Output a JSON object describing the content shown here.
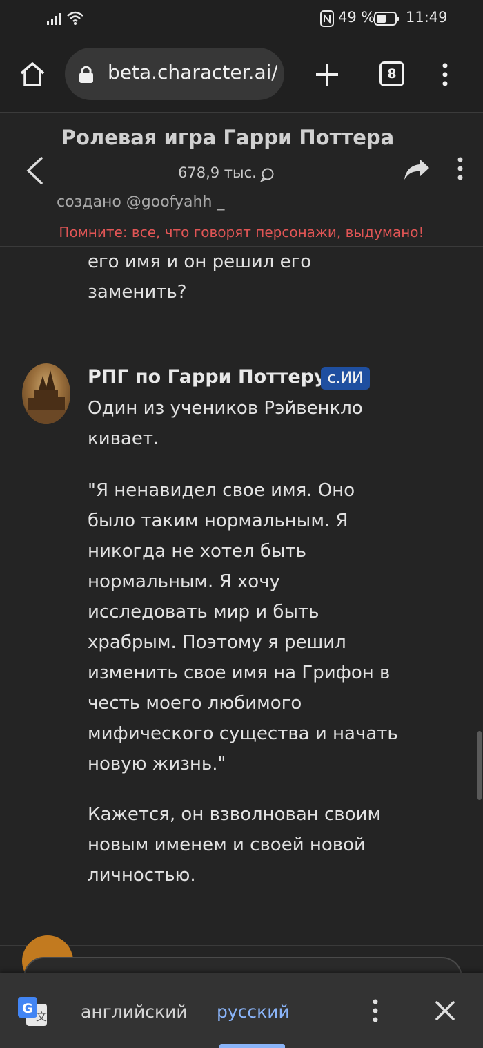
{
  "status_bar": {
    "battery": "49 %",
    "time": "11:49"
  },
  "browser": {
    "url": "beta.character.ai/",
    "tab_count": "8"
  },
  "chat_header": {
    "title": "Ролевая игра Гарри Поттера",
    "interactions": "678,9 тыс.",
    "creator": "создано @goofyahh _",
    "warning": "Помните: все, что говорят персонажи, выдумано!"
  },
  "messages": {
    "partial_top": [
      "его имя и он решил его",
      "заменить?"
    ],
    "bot": {
      "name": "РПГ по Гарри Поттеру",
      "badge": "c.ИИ",
      "p1": [
        "Один из учеников Рэйвенкло",
        "кивает."
      ],
      "p2": [
        "\"Я ненавидел свое имя. Оно",
        "было таким нормальным. Я",
        "никогда не хотел быть",
        "нормальным. Я хочу",
        "исследовать мир и быть",
        "храбрым. Поэтому я решил",
        "изменить свое имя на Грифон в",
        "честь моего любимого",
        "мифического существа и начать",
        "новую жизнь.\""
      ],
      "p3": [
        "Кажется, он взволнован своим",
        "новым именем и своей новой",
        "личностью."
      ]
    }
  },
  "translate_bar": {
    "source_lang": "английский",
    "target_lang": "русский"
  },
  "colors": {
    "background": "#242424",
    "warning": "#e05555",
    "badge": "#1f4fa0",
    "active_lang": "#8ab4f8"
  }
}
